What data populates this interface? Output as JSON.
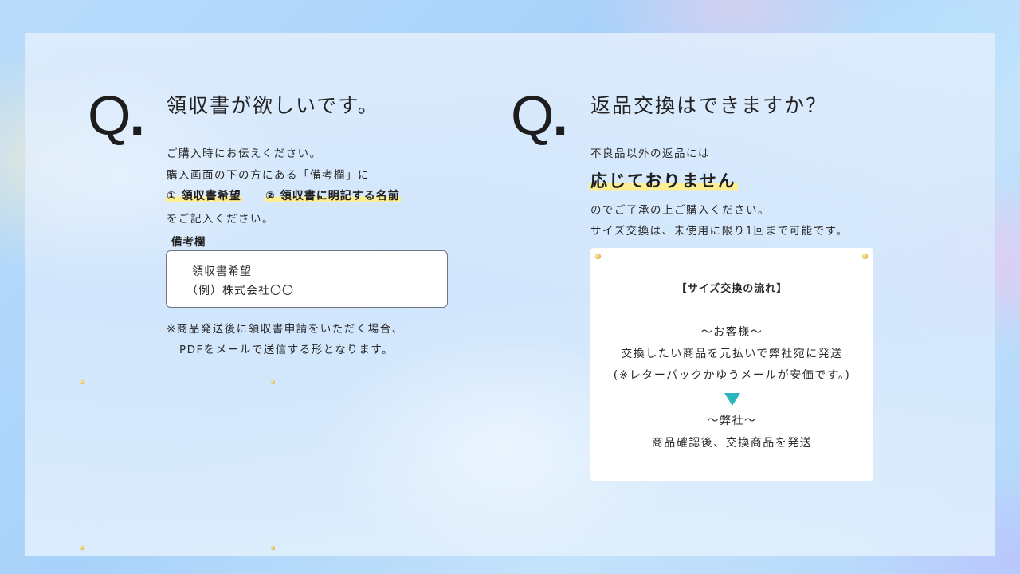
{
  "left": {
    "q_mark": "Q",
    "q_dot": ".",
    "title": "領収書が欲しいです。",
    "lines": [
      "ご購入時にお伝えください。",
      "購入画面の下の方にある「備考欄」に"
    ],
    "highlight_item_1": "① 領収書希望",
    "highlight_item_2": "② 領収書に明記する名前",
    "line_after": "をご記入ください。",
    "remarks_label": "備考欄",
    "remarks_box": {
      "line1": "領収書希望",
      "line2": "（例）株式会社〇〇"
    },
    "note_line1": "※商品発送後に領収書申請をいただく場合、",
    "note_line2": "PDFをメールで送信する形となります。"
  },
  "right": {
    "q_mark": "Q",
    "q_dot": ".",
    "title": "返品交換はできますか？",
    "intro": "不良品以外の返品には",
    "emphasis": "応じておりません",
    "line1": "のでご了承の上ご購入ください。",
    "line2": "サイズ交換は、未使用に限り1回まで可能です。",
    "flow": {
      "title": "【サイズ交換の流れ】",
      "customer_heading": "～お客様～",
      "customer_line1": "交換したい商品を元払いで弊社宛に発送",
      "customer_line2": "(※レターパックかゆうメールが安価です。)",
      "company_heading": "～弊社～",
      "company_line": "商品確認後、交換商品を発送"
    }
  },
  "colors": {
    "arrow": "#2bb5c0",
    "highlight": "#ffee8c",
    "pin": "#e8c04f"
  }
}
